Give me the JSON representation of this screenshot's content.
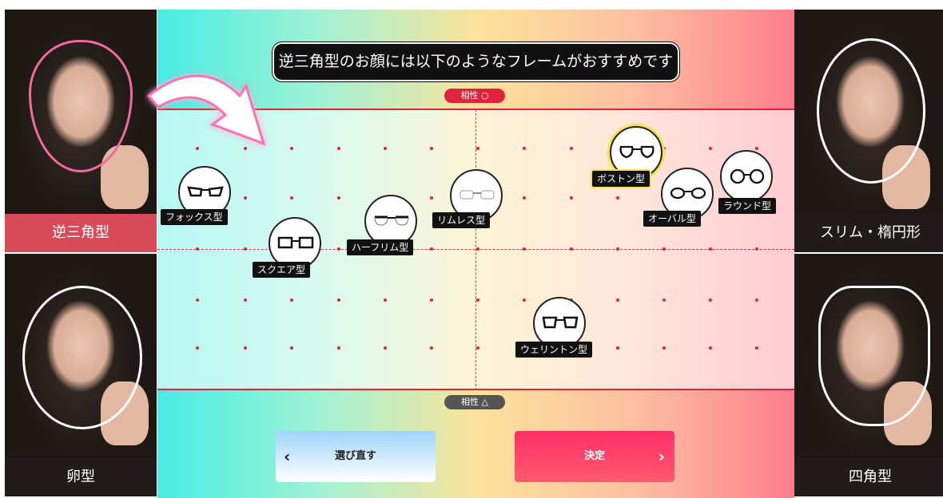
{
  "title": "逆三角型のお顔には以下のようなフレームがおすすめです",
  "axis": {
    "top_label": "相性 ○",
    "bottom_label": "相性 △"
  },
  "face_types": [
    {
      "label": "逆三角型",
      "selected": true
    },
    {
      "label": "卵型",
      "selected": false
    },
    {
      "label": "スリム・楕円形",
      "selected": false
    },
    {
      "label": "四角型",
      "selected": false
    }
  ],
  "frames": [
    {
      "label": "フォックス型",
      "highlighted": false
    },
    {
      "label": "スクエア型",
      "highlighted": false
    },
    {
      "label": "ハーフリム型",
      "highlighted": false
    },
    {
      "label": "リムレス型",
      "highlighted": false
    },
    {
      "label": "ボストン型",
      "highlighted": true
    },
    {
      "label": "オーバル型",
      "highlighted": false
    },
    {
      "label": "ラウンド型",
      "highlighted": false
    },
    {
      "label": "ウェリントン型",
      "highlighted": false
    }
  ],
  "buttons": {
    "back_label": "選び直す",
    "ok_label": "決定"
  },
  "colors": {
    "accent_red": "#e0233d",
    "selected_label": "#d84a58",
    "highlight": "#f7e24d"
  },
  "icons": [
    "arrow-curved-icon",
    "chevron-left-icon",
    "chevron-right-icon",
    "glasses-icon"
  ]
}
